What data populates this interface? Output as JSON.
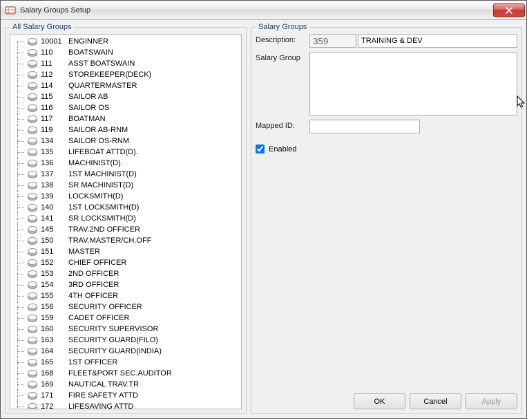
{
  "window": {
    "title": "Salary Groups Setup"
  },
  "left": {
    "legend": "All Salary Groups",
    "items": [
      {
        "code": "10001",
        "name": "ENGINNER"
      },
      {
        "code": "110",
        "name": "BOATSWAIN"
      },
      {
        "code": "111",
        "name": "ASST BOATSWAIN"
      },
      {
        "code": "112",
        "name": "STOREKEEPER(DECK)"
      },
      {
        "code": "114",
        "name": "QUARTERMASTER"
      },
      {
        "code": "115",
        "name": "SAILOR AB"
      },
      {
        "code": "116",
        "name": "SAILOR OS"
      },
      {
        "code": "117",
        "name": "BOATMAN"
      },
      {
        "code": "119",
        "name": "SAILOR AB-RNM"
      },
      {
        "code": "134",
        "name": "SAILOR OS-RNM"
      },
      {
        "code": "135",
        "name": "LIFEBOAT ATTD(D)."
      },
      {
        "code": "136",
        "name": "MACHINIST(D)."
      },
      {
        "code": "137",
        "name": "1ST MACHINIST(D)"
      },
      {
        "code": "138",
        "name": "SR MACHINIST(D)"
      },
      {
        "code": "139",
        "name": "LOCKSMITH(D)"
      },
      {
        "code": "140",
        "name": "1ST LOCKSMITH(D)"
      },
      {
        "code": "141",
        "name": "SR LOCKSMITH(D)"
      },
      {
        "code": "145",
        "name": "TRAV.2ND OFFICER"
      },
      {
        "code": "150",
        "name": "TRAV.MASTER/CH.OFF"
      },
      {
        "code": "151",
        "name": "MASTER"
      },
      {
        "code": "152",
        "name": "CHIEF OFFICER"
      },
      {
        "code": "153",
        "name": "2ND OFFICER"
      },
      {
        "code": "154",
        "name": "3RD OFFICER"
      },
      {
        "code": "155",
        "name": "4TH OFFICER"
      },
      {
        "code": "156",
        "name": "SECURITY OFFICER"
      },
      {
        "code": "159",
        "name": "CADET OFFICER"
      },
      {
        "code": "160",
        "name": "SECURITY SUPERVISOR"
      },
      {
        "code": "163",
        "name": "SECURITY GUARD(FILO)"
      },
      {
        "code": "164",
        "name": "SECURITY GUARD(INDIA)"
      },
      {
        "code": "165",
        "name": "1ST OFFICER"
      },
      {
        "code": "168",
        "name": "FLEET&PORT SEC.AUDITOR"
      },
      {
        "code": "169",
        "name": "NAUTICAL TRAV.TR"
      },
      {
        "code": "171",
        "name": "FIRE SAFETY ATTD"
      },
      {
        "code": "172",
        "name": "LIFESAVING ATTD"
      }
    ]
  },
  "right": {
    "legend": "Salary Groups",
    "description_label": "Description:",
    "description_code": "359",
    "description_name": "TRAINING & DEV",
    "salary_group_label": "Salary Group",
    "salary_group_value": "",
    "mapped_id_label": "Mapped ID:",
    "mapped_id_value": "",
    "enabled_label": "Enabled",
    "enabled_checked": true
  },
  "buttons": {
    "ok": "OK",
    "cancel": "Cancel",
    "apply": "Apply"
  }
}
